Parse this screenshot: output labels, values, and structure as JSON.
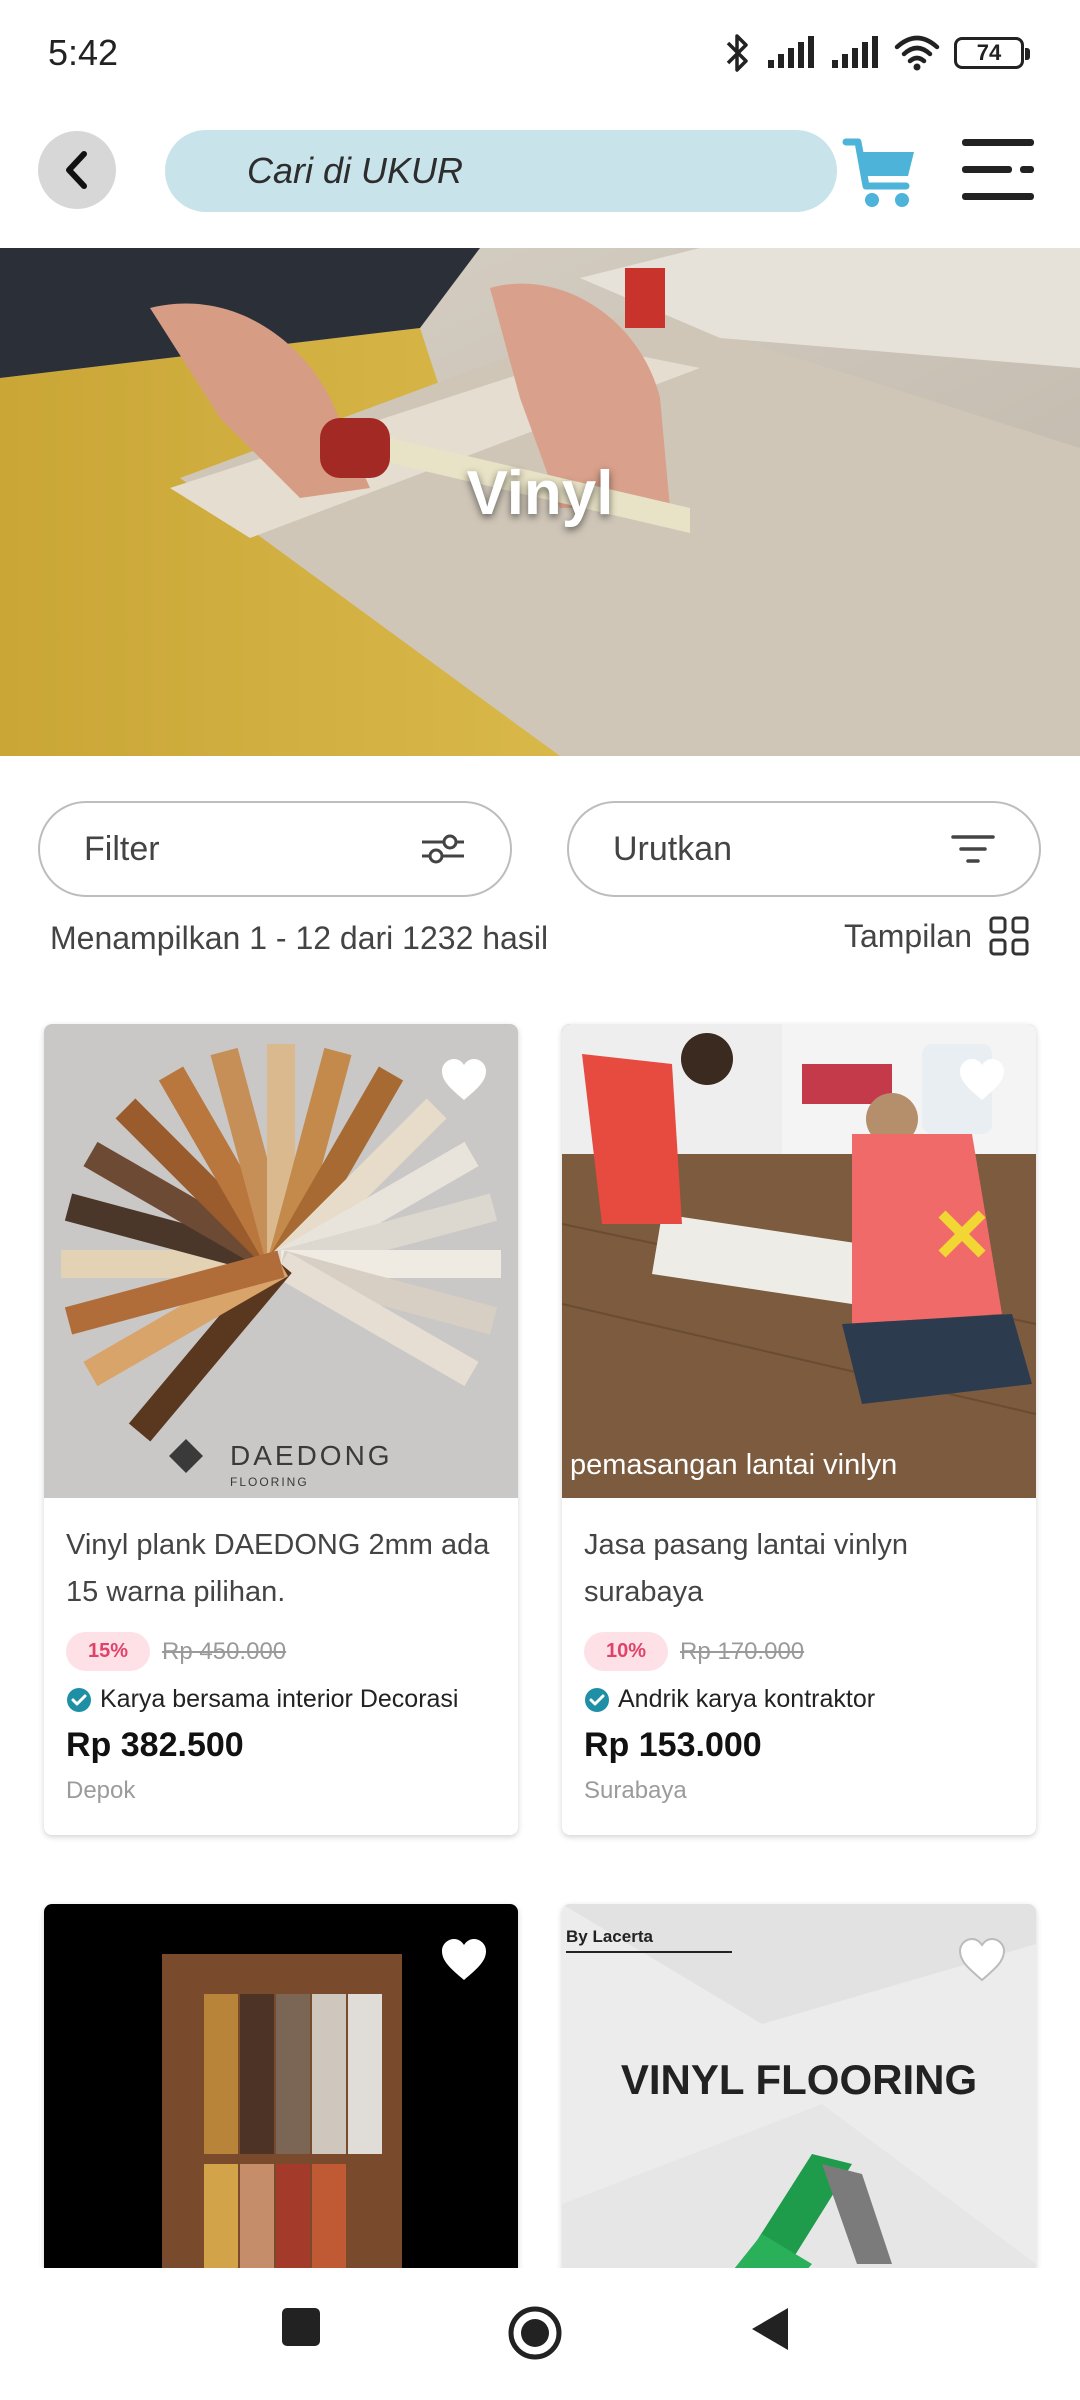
{
  "status_bar": {
    "time": "5:42",
    "battery": "74"
  },
  "top_nav": {
    "search_placeholder": "Cari di UKUR"
  },
  "hero": {
    "title": "Vinyl"
  },
  "toolbar": {
    "filter_label": "Filter",
    "sort_label": "Urutkan",
    "results_text": "Menampilkan 1 - 12 dari 1232 hasil",
    "view_label": "Tampilan"
  },
  "products": [
    {
      "title": "Vinyl plank DAEDONG 2mm ada 15 warna pilihan.",
      "discount": "15%",
      "old_price": "Rp 450.000",
      "seller": "Karya bersama interior Decorasi",
      "price": "Rp 382.500",
      "location": "Depok",
      "image_caption": "DAEDONG",
      "image_subcaption": "FLOORING"
    },
    {
      "title": "Jasa pasang lantai vinlyn surabaya",
      "discount": "10%",
      "old_price": "Rp 170.000",
      "seller": "Andrik karya kontraktor",
      "price": "Rp 153.000",
      "location": "Surabaya",
      "image_caption": "pemasangan lantai vinlyn"
    },
    {
      "title": "",
      "image_caption": ""
    },
    {
      "title": "",
      "image_caption": "VINYL FLOORING",
      "image_subcaption": "By Lacerta"
    }
  ],
  "colors": {
    "search_bg": "#c8e3ea",
    "cart": "#4db3d9",
    "discount_bg": "#fde1e6",
    "discount_text": "#e0436a",
    "verified": "#1f8fa6"
  }
}
